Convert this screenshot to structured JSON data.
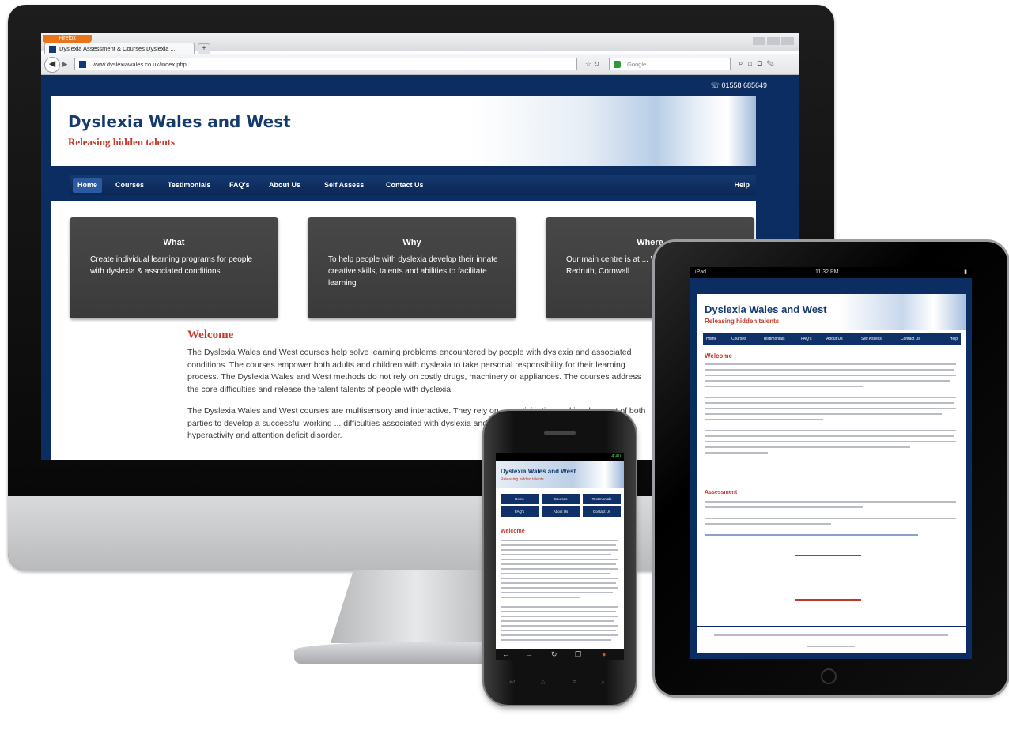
{
  "browser": {
    "app_menu": "Firefox",
    "tab_title": "Dyslexia Assessment & Courses Dyslexia ...",
    "new_tab": "+",
    "url": "www.dyslexiawales.co.uk/index.php",
    "search_placeholder": "Google"
  },
  "site": {
    "phone": "01558 685649",
    "title": "Dyslexia Wales and West",
    "tagline": "Releasing hidden talents",
    "nav": [
      "Home",
      "Courses",
      "Testimonials",
      "FAQ's",
      "About Us",
      "Self Assess",
      "Contact Us"
    ],
    "nav_help": "Help",
    "boxes": [
      {
        "heading": "What",
        "text": "Create individual learning programs for people with dyslexia & associated conditions"
      },
      {
        "heading": "Why",
        "text": "To help people with dyslexia develop their innate creative skills, talents and abilities to facilitate learning"
      },
      {
        "heading": "Where",
        "text": "Our main centre is at ... We also have facilities ... Redruth, Cornwall"
      }
    ],
    "welcome": "Welcome",
    "para1": "The Dyslexia Wales and West courses help solve learning problems encountered by people with dyslexia and associated conditions. The courses empower both adults and children with dyslexia to take personal responsibility for their learning process. The Dyslexia Wales and West methods do not rely on costly drugs, machinery or appliances. The courses address the core difficulties and release the talent talents of people with dyslexia.",
    "para2": "The Dyslexia Wales and West courses are multisensory and interactive. They rely on ... participation and involvement of both parties to develop a successful working ... difficulties associated with dyslexia and similar conditions such as dyspraxia, ... hyperactivity and attention deficit disorder."
  },
  "tablet": {
    "status_left": "iPad",
    "status_time": "11:32 PM",
    "title": "Dyslexia Wales and West",
    "tagline": "Releasing hidden talents",
    "nav": [
      "Home",
      "Courses",
      "Testimonials",
      "FAQ's",
      "About Us",
      "Self Assess",
      "Contact Us",
      "Help"
    ],
    "welcome": "Welcome",
    "assessment": "Assessment"
  },
  "phone": {
    "status": "4:40",
    "title": "Dyslexia Wales and West",
    "tagline": "Releasing hidden talents",
    "nav": [
      "Home",
      "Courses",
      "Testimonials",
      "FAQ's",
      "About Us",
      "Contact Us"
    ],
    "welcome": "Welcome"
  },
  "colors": {
    "navy": "#0c2d62",
    "red": "#c0392b",
    "box_grey": "#404040"
  }
}
